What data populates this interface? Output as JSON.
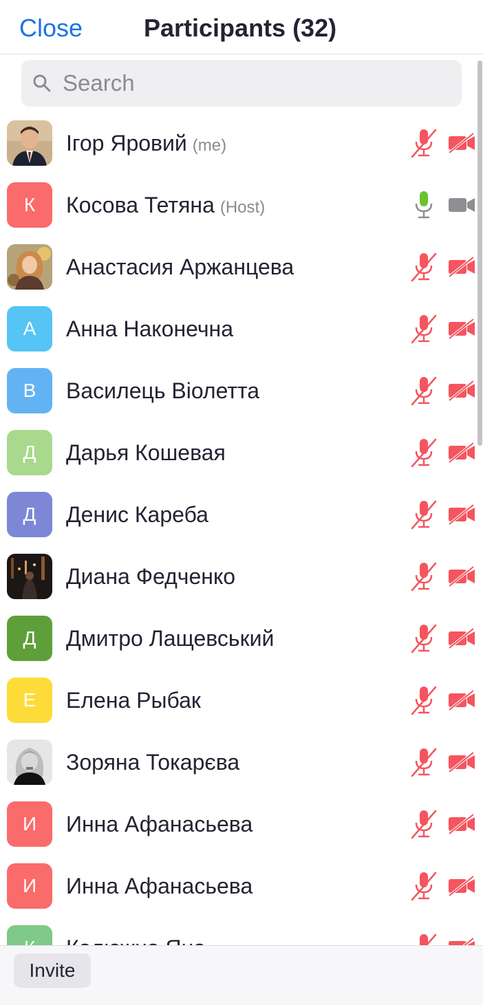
{
  "header": {
    "close_label": "Close",
    "title": "Participants (32)"
  },
  "search": {
    "placeholder": "Search",
    "value": ""
  },
  "participants": [
    {
      "name": "Ігор Яровий",
      "tag": "(me)",
      "avatar_type": "photo",
      "mic": "muted",
      "video": "off"
    },
    {
      "name": "Косова Тетяна",
      "tag": "(Host)",
      "avatar_type": "initial",
      "initial": "К",
      "avatar_color": "#fa6b6b",
      "mic": "active",
      "video": "on"
    },
    {
      "name": "Анастасия Аржанцева",
      "tag": "",
      "avatar_type": "photo",
      "mic": "muted",
      "video": "off"
    },
    {
      "name": "Анна Наконечна",
      "tag": "",
      "avatar_type": "initial",
      "initial": "А",
      "avatar_color": "#56c4f5",
      "mic": "muted",
      "video": "off"
    },
    {
      "name": "Василець Віолетта",
      "tag": "",
      "avatar_type": "initial",
      "initial": "В",
      "avatar_color": "#63b3f3",
      "mic": "muted",
      "video": "off"
    },
    {
      "name": "Дарья Кошевая",
      "tag": "",
      "avatar_type": "initial",
      "initial": "Д",
      "avatar_color": "#a9d98c",
      "mic": "muted",
      "video": "off"
    },
    {
      "name": "Денис Кареба",
      "tag": "",
      "avatar_type": "initial",
      "initial": "Д",
      "avatar_color": "#7d87d6",
      "mic": "muted",
      "video": "off"
    },
    {
      "name": "Диана Федченко",
      "tag": "",
      "avatar_type": "photo",
      "mic": "muted",
      "video": "off"
    },
    {
      "name": "Дмитро Лащевський",
      "tag": "",
      "avatar_type": "initial",
      "initial": "Д",
      "avatar_color": "#5f9f3a",
      "mic": "muted",
      "video": "off"
    },
    {
      "name": "Елена Рыбак",
      "tag": "",
      "avatar_type": "initial",
      "initial": "Е",
      "avatar_color": "#fddc3a",
      "mic": "muted",
      "video": "off"
    },
    {
      "name": "Зоряна Токарєва",
      "tag": "",
      "avatar_type": "photo",
      "mic": "muted",
      "video": "off"
    },
    {
      "name": "Инна Афанасьева",
      "tag": "",
      "avatar_type": "initial",
      "initial": "И",
      "avatar_color": "#fa6b6b",
      "mic": "muted",
      "video": "off"
    },
    {
      "name": "Инна Афанасьева",
      "tag": "",
      "avatar_type": "initial",
      "initial": "И",
      "avatar_color": "#fa6b6b",
      "mic": "muted",
      "video": "off"
    },
    {
      "name": "Калюжна Яна",
      "tag": "",
      "avatar_type": "initial",
      "initial": "К",
      "avatar_color": "#7fc98a",
      "mic": "muted",
      "video": "off"
    }
  ],
  "footer": {
    "invite_label": "Invite"
  },
  "colors": {
    "accent": "#1a73e8",
    "muted": "#f4555f",
    "active_mic": "#6cc22f",
    "video_on": "#8e8e93"
  },
  "icons": {
    "search": "search-icon",
    "mic_muted": "mic-muted-icon",
    "mic_active": "mic-icon",
    "video_off": "video-off-icon",
    "video_on": "video-icon"
  }
}
